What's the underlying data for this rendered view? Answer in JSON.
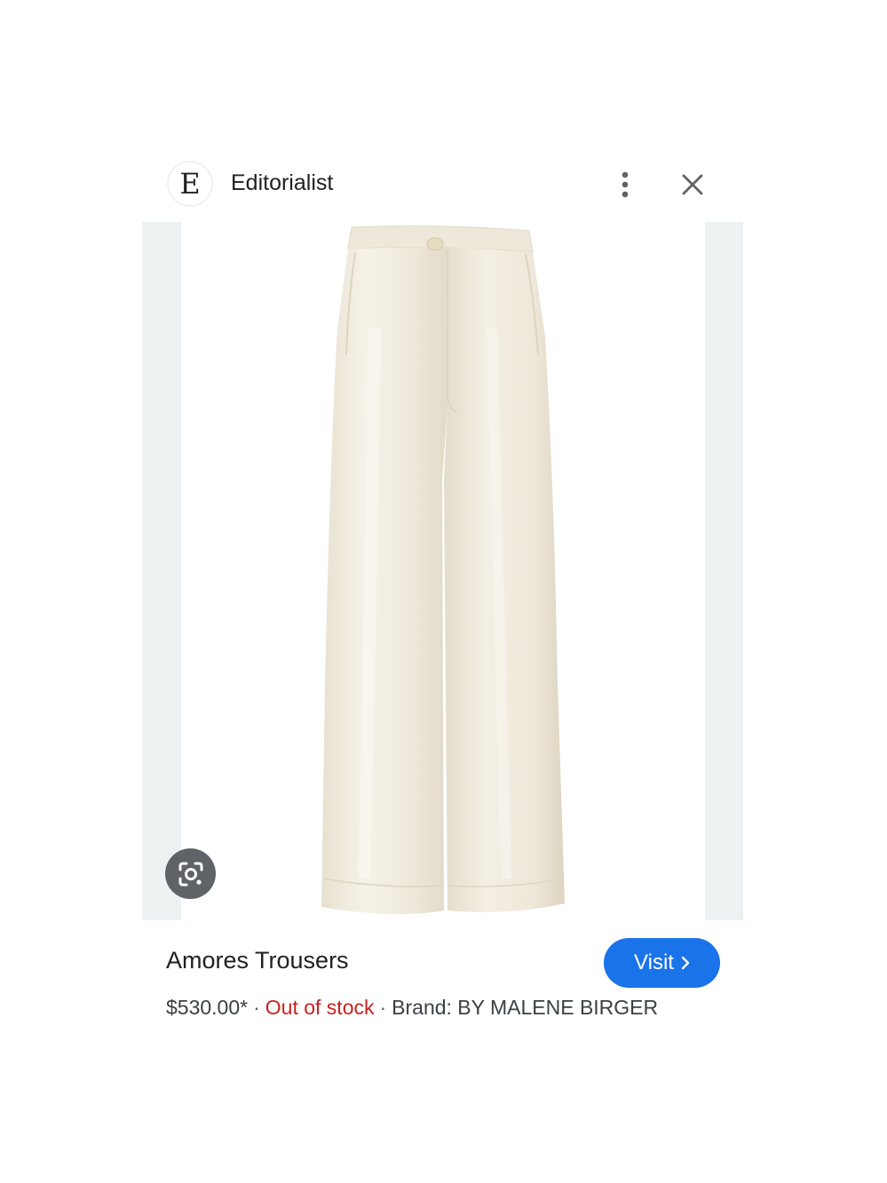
{
  "header": {
    "logo_letter": "E",
    "site_name": "Editorialist",
    "more_icon": "more-vert-icon",
    "close_icon": "close-icon"
  },
  "image": {
    "alt": "Amores Trousers",
    "lens_icon": "google-lens-icon"
  },
  "product": {
    "title": "Amores Trousers",
    "price": "$530.00*",
    "separator": "·",
    "stock_status": "Out of stock",
    "brand": "Brand: BY MALENE BIRGER",
    "visit_label": "Visit",
    "visit_icon": "chevron-right-icon"
  },
  "colors": {
    "accent": "#1a73e8",
    "out_of_stock": "#c5221f",
    "image_frame": "#edf1f2"
  }
}
